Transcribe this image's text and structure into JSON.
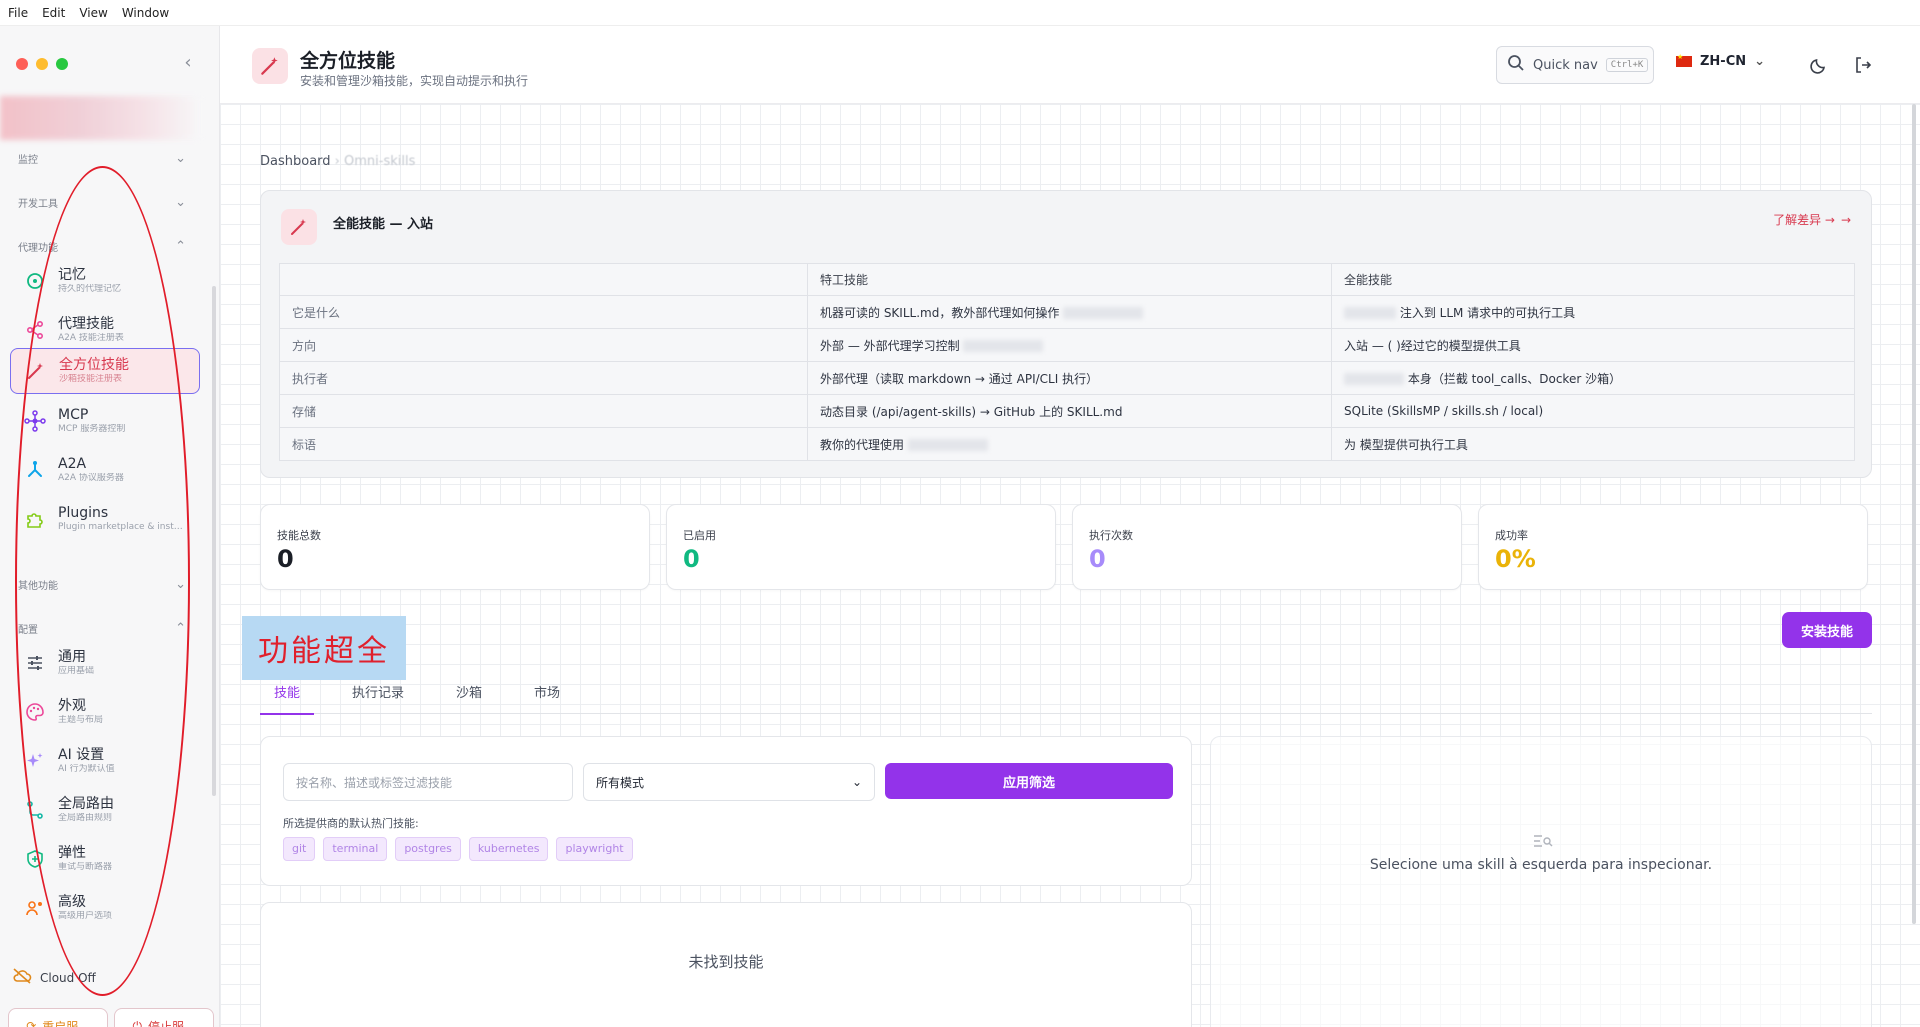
{
  "menubar": [
    "File",
    "Edit",
    "View",
    "Window"
  ],
  "sidebar": {
    "sections": [
      {
        "label": "监控",
        "chev": "⌄"
      },
      {
        "label": "开发工具",
        "chev": "⌄"
      },
      {
        "label": "代理功能",
        "chev": "⌃"
      },
      {
        "label": "其他功能",
        "chev": "⌄"
      },
      {
        "label": "配置",
        "chev": "⌃"
      }
    ],
    "items": [
      {
        "label": "记忆",
        "sub": "持久的代理记忆",
        "icon": "memory-icon"
      },
      {
        "label": "代理技能",
        "sub": "A2A 技能注册表",
        "icon": "share-icon"
      },
      {
        "label": "全方位技能",
        "sub": "沙箱技能注册表",
        "icon": "magic-wand-icon"
      },
      {
        "label": "MCP",
        "sub": "MCP 服务器控制",
        "icon": "network-icon"
      },
      {
        "label": "A2A",
        "sub": "A2A 协议服务器",
        "icon": "fork-icon"
      },
      {
        "label": "Plugins",
        "sub": "Plugin marketplace & installed",
        "icon": "puzzle-icon"
      },
      {
        "label": "通用",
        "sub": "应用基础",
        "icon": "sliders-icon"
      },
      {
        "label": "外观",
        "sub": "主题与布局",
        "icon": "palette-icon"
      },
      {
        "label": "AI 设置",
        "sub": "AI 行为默认值",
        "icon": "sparkles-icon"
      },
      {
        "label": "全局路由",
        "sub": "全局路由规则",
        "icon": "route-icon"
      },
      {
        "label": "弹性",
        "sub": "重试与断路器",
        "icon": "shield-plus-icon"
      },
      {
        "label": "高级",
        "sub": "高级用户选项",
        "icon": "users-gear-icon"
      }
    ],
    "cloud_label": "Cloud Off",
    "restart_label": "重启服...",
    "stop_label": "停止服..."
  },
  "header": {
    "title": "全方位技能",
    "subtitle": "安装和管理沙箱技能，实现自动提示和执行",
    "quicknav_label": "Quick nav",
    "quicknav_kbd": "Ctrl+K",
    "lang": "ZH-CN"
  },
  "breadcrumb": {
    "root": "Dashboard",
    "sep": "›",
    "current": "Omni-skills"
  },
  "comparison": {
    "title": "全能技能 — 入站",
    "link": "了解差异 →",
    "headers": [
      "",
      "特工技能",
      "全能技能"
    ],
    "rows": [
      {
        "label": "它是什么",
        "a": "机器可读的 SKILL.md，教外部代理如何操作",
        "b": "注入到 LLM 请求中的可执行工具"
      },
      {
        "label": "方向",
        "a": "外部 — 外部代理学习控制",
        "b": "入站 — (        )经过它的模型提供工具"
      },
      {
        "label": "执行者",
        "a": "外部代理（读取 markdown → 通过 API/CLI 执行）",
        "b": "本身（拦截 tool_calls、Docker 沙箱）"
      },
      {
        "label": "存储",
        "a": "动态目录 (/api/agent-skills) → GitHub 上的 SKILL.md",
        "b": "SQLite (SkillsMP / skills.sh / local)"
      },
      {
        "label": "标语",
        "a": "教你的代理使用",
        "b": "为          模型提供可执行工具"
      }
    ]
  },
  "stats": [
    {
      "label": "技能总数",
      "value": "0",
      "color": "#1b1f27"
    },
    {
      "label": "已启用",
      "value": "0",
      "color": "#10b981"
    },
    {
      "label": "执行次数",
      "value": "0",
      "color": "#a78bfa"
    },
    {
      "label": "成功率",
      "value": "0%",
      "color": "#eab308"
    }
  ],
  "install_label": "安装技能",
  "annotation_text": "功能超全",
  "tabs": [
    "技能",
    "执行记录",
    "沙箱",
    "市场"
  ],
  "filter": {
    "placeholder": "按名称、描述或标签过滤技能",
    "mode_selected": "所有模式",
    "apply_label": "应用筛选",
    "hint": "所选提供商的默认热门技能:",
    "chips": [
      "git",
      "terminal",
      "postgres",
      "kubernetes",
      "playwright"
    ]
  },
  "empty_msg": "未找到技能",
  "inspect_msg": "Selecione uma skill à esquerda para inspecionar.",
  "colors": {
    "accent": "#9333ea",
    "brand_red": "#d8394f",
    "active_bg": "#fbe7ea"
  }
}
